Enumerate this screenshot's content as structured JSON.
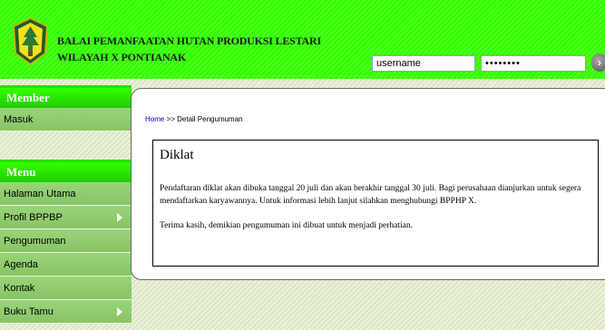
{
  "header": {
    "org_line1": "BALAI PEMANFAATAN HUTAN PRODUKSI LESTARI",
    "org_line2": "WILAYAH X PONTIANAK",
    "username_value": "username",
    "password_value": "••••••••",
    "login_glyph": "›",
    "logo_icon": "tree-emblem-icon"
  },
  "sidebar": {
    "member_heading": "Member",
    "member_items": [
      {
        "label": "Masuk"
      }
    ],
    "menu_heading": "Menu",
    "menu_items": [
      {
        "label": "Halaman Utama"
      },
      {
        "label": "Profil BPPBP"
      },
      {
        "label": "Pengumuman"
      },
      {
        "label": "Agenda"
      },
      {
        "label": "Kontak"
      },
      {
        "label": "Buku Tamu"
      }
    ]
  },
  "main": {
    "breadcrumb_home": "Home",
    "breadcrumb_rest": " >> Detail Pengumuman",
    "title": "Diklat",
    "paragraph1": "Pendaftaran diklat akan dibuka tanggal 20 juli dan akan berakhir tanggal 30 juli. Bagi perusahaan dianjurkan untuk segera mendaftarkan karyawannya. Untuk informasi lebih lanjut silahkan menghubungi BPPHP X.",
    "paragraph2": "Terima kasih, demikian pengumuman ini dibuat untuk menjadi perhatian."
  }
}
